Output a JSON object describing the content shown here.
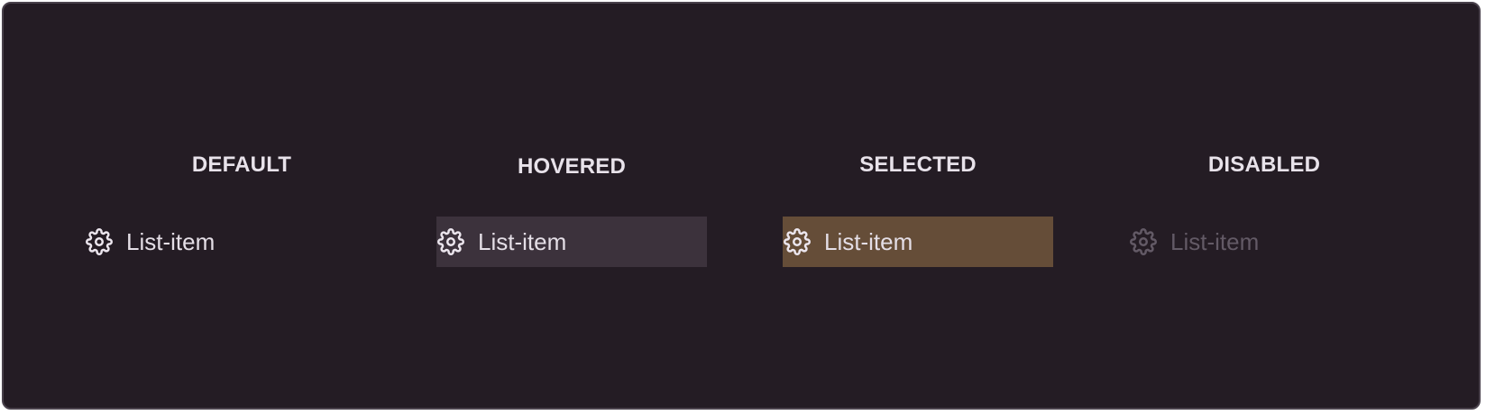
{
  "states": [
    {
      "key": "default",
      "label": "DEFAULT",
      "item_label": "List-item",
      "icon": "gear-icon"
    },
    {
      "key": "hovered",
      "label": "HOVERED",
      "item_label": "List-item",
      "icon": "gear-icon"
    },
    {
      "key": "selected",
      "label": "SELECTED",
      "item_label": "List-item",
      "icon": "gear-icon"
    },
    {
      "key": "disabled",
      "label": "DISABLED",
      "item_label": "List-item",
      "icon": "gear-icon"
    }
  ],
  "colors": {
    "background": "#241c24",
    "hovered_background": "#3c323c",
    "selected_background": "#654d38",
    "text": "#e4dee6",
    "disabled_text": "#635a66"
  }
}
